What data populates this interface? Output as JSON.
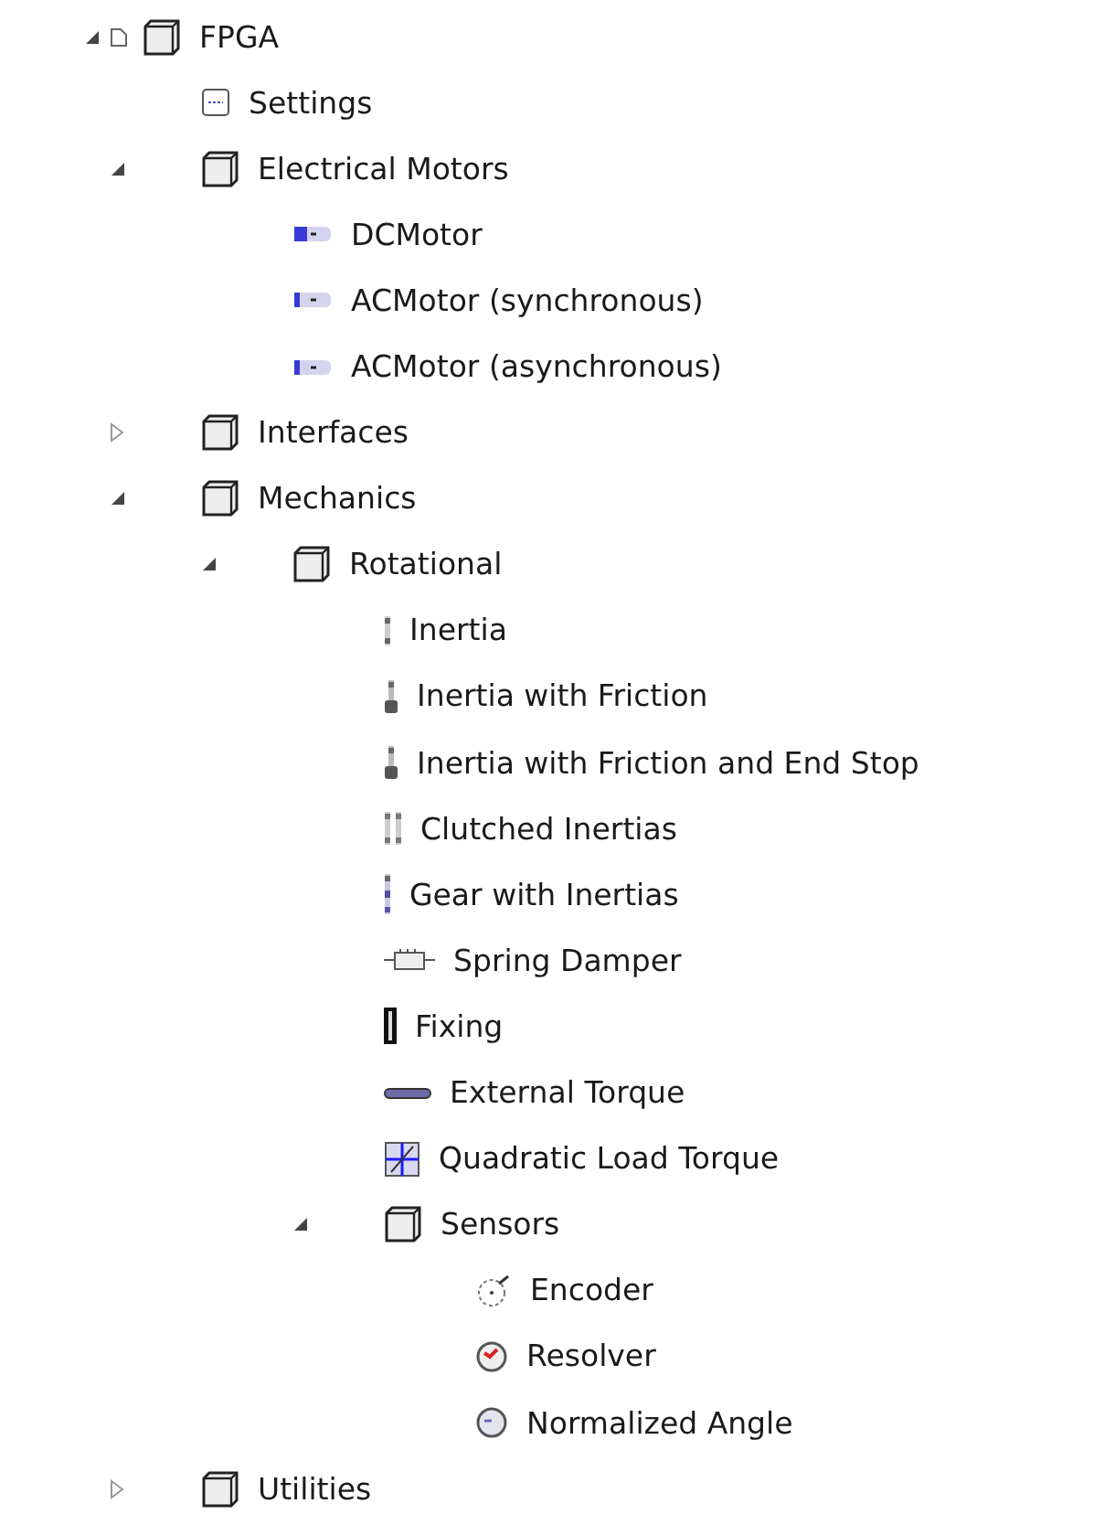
{
  "tree": [
    {
      "label": "FPGA",
      "kind": "root",
      "expanded": true,
      "children": [
        {
          "label": "Settings",
          "kind": "settings"
        },
        {
          "label": "Electrical Motors",
          "kind": "folder",
          "expanded": true,
          "children": [
            {
              "label": "DCMotor",
              "kind": "motor-dc"
            },
            {
              "label": "ACMotor (synchronous)",
              "kind": "motor"
            },
            {
              "label": "ACMotor (asynchronous)",
              "kind": "motor"
            }
          ]
        },
        {
          "label": "Interfaces",
          "kind": "folder",
          "expanded": false
        },
        {
          "label": "Mechanics",
          "kind": "folder",
          "expanded": true,
          "children": [
            {
              "label": "Rotational",
              "kind": "folder",
              "expanded": true,
              "children": [
                {
                  "label": "Inertia",
                  "kind": "inertia"
                },
                {
                  "label": "Inertia with Friction",
                  "kind": "friction"
                },
                {
                  "label": "Inertia with Friction and End Stop",
                  "kind": "friction"
                },
                {
                  "label": "Clutched Inertias",
                  "kind": "clutch"
                },
                {
                  "label": "Gear with Inertias",
                  "kind": "gear"
                },
                {
                  "label": "Spring Damper",
                  "kind": "spring"
                },
                {
                  "label": "Fixing",
                  "kind": "fixing"
                },
                {
                  "label": "External Torque",
                  "kind": "torque"
                },
                {
                  "label": "Quadratic Load Torque",
                  "kind": "quadratic"
                },
                {
                  "label": "Sensors",
                  "kind": "folder",
                  "expanded": true,
                  "children": [
                    {
                      "label": "Encoder",
                      "kind": "encoder"
                    },
                    {
                      "label": "Resolver",
                      "kind": "resolver"
                    },
                    {
                      "label": "Normalized Angle",
                      "kind": "angle"
                    }
                  ]
                }
              ]
            }
          ]
        },
        {
          "label": "Utilities",
          "kind": "folder",
          "expanded": false
        }
      ]
    }
  ]
}
